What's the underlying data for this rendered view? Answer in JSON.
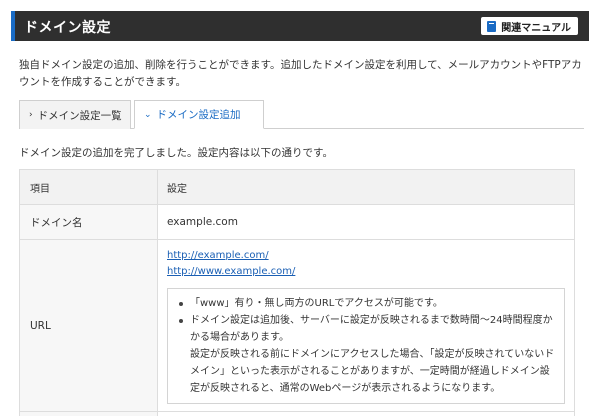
{
  "header": {
    "title": "ドメイン設定",
    "manual_button": "関連マニュアル",
    "accent_color": "#1a6bc4",
    "icon": "book-icon"
  },
  "intro": "独自ドメイン設定の追加、削除を行うことができます。追加したドメイン設定を利用して、メールアカウントやFTPアカウントを作成することができます。",
  "tabs": [
    {
      "label": "ドメイン設定一覧",
      "active": false,
      "icon": "chevron-right-icon"
    },
    {
      "label": "ドメイン設定追加",
      "active": true,
      "icon": "chevron-down-icon"
    }
  ],
  "complete_message": "ドメイン設定の追加を完了しました。設定内容は以下の通りです。",
  "table": {
    "headers": {
      "item": "項目",
      "setting": "設定"
    },
    "domain_row": {
      "label": "ドメイン名",
      "value": "example.com"
    },
    "url_row": {
      "label": "URL",
      "links": [
        "http://example.com/",
        "http://www.example.com/"
      ],
      "notes": {
        "note1": "「www」有り・無し両方のURLでアクセスが可能です。",
        "note2_p1": "ドメイン設定は追加後、サーバーに設定が反映されるまで数時間～24時間程度かかる場合があります。",
        "note2_p2": "設定が反映される前にドメインにアクセスした場合、「設定が反映されていないドメイン」といった表示がされることがありますが、一定時間が経過しドメイン設定が反映されると、通常のWebページが表示されるようになります。"
      }
    }
  }
}
